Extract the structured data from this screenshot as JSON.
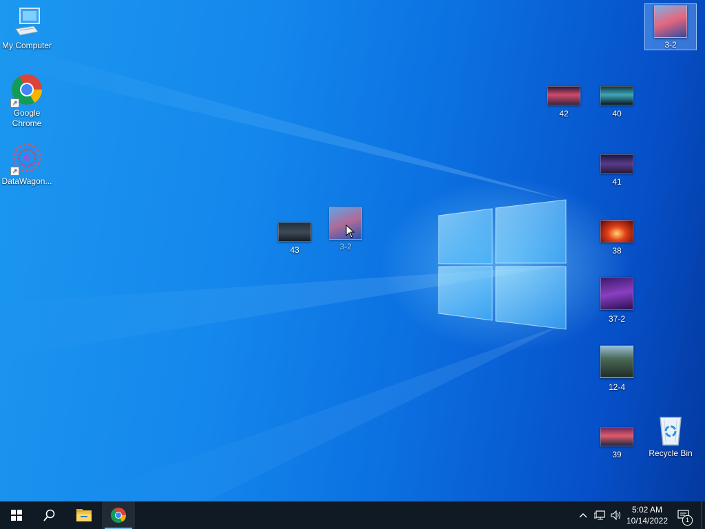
{
  "desktop": {
    "icons": [
      {
        "label": "My Computer",
        "icon": "computer-icon"
      },
      {
        "label": "Google Chrome",
        "icon": "chrome-icon"
      },
      {
        "label": "DataWagon...",
        "icon": "datawagon-icon"
      },
      {
        "label": "3-2",
        "icon": "image-thumbnail",
        "selected": true
      },
      {
        "label": "42",
        "icon": "image-thumbnail"
      },
      {
        "label": "40",
        "icon": "image-thumbnail"
      },
      {
        "label": "41",
        "icon": "image-thumbnail"
      },
      {
        "label": "43",
        "icon": "image-thumbnail"
      },
      {
        "label": "3-2",
        "icon": "image-thumbnail",
        "dragging": true
      },
      {
        "label": "38",
        "icon": "image-thumbnail"
      },
      {
        "label": "37-2",
        "icon": "image-thumbnail"
      },
      {
        "label": "12-4",
        "icon": "image-thumbnail"
      },
      {
        "label": "39",
        "icon": "image-thumbnail"
      },
      {
        "label": "Recycle Bin",
        "icon": "recycle-bin-icon"
      }
    ]
  },
  "taskbar": {
    "buttons": [
      "start-icon",
      "search-icon",
      "file-explorer-icon",
      "chrome-icon"
    ],
    "tray": [
      "chevron-up-icon",
      "network-icon",
      "volume-icon"
    ],
    "clock": {
      "time": "5:02 AM",
      "date": "10/14/2022"
    },
    "notifications": {
      "count": "1"
    }
  },
  "colors": {
    "accent": "#1487ec",
    "taskbar": "#101a24"
  }
}
